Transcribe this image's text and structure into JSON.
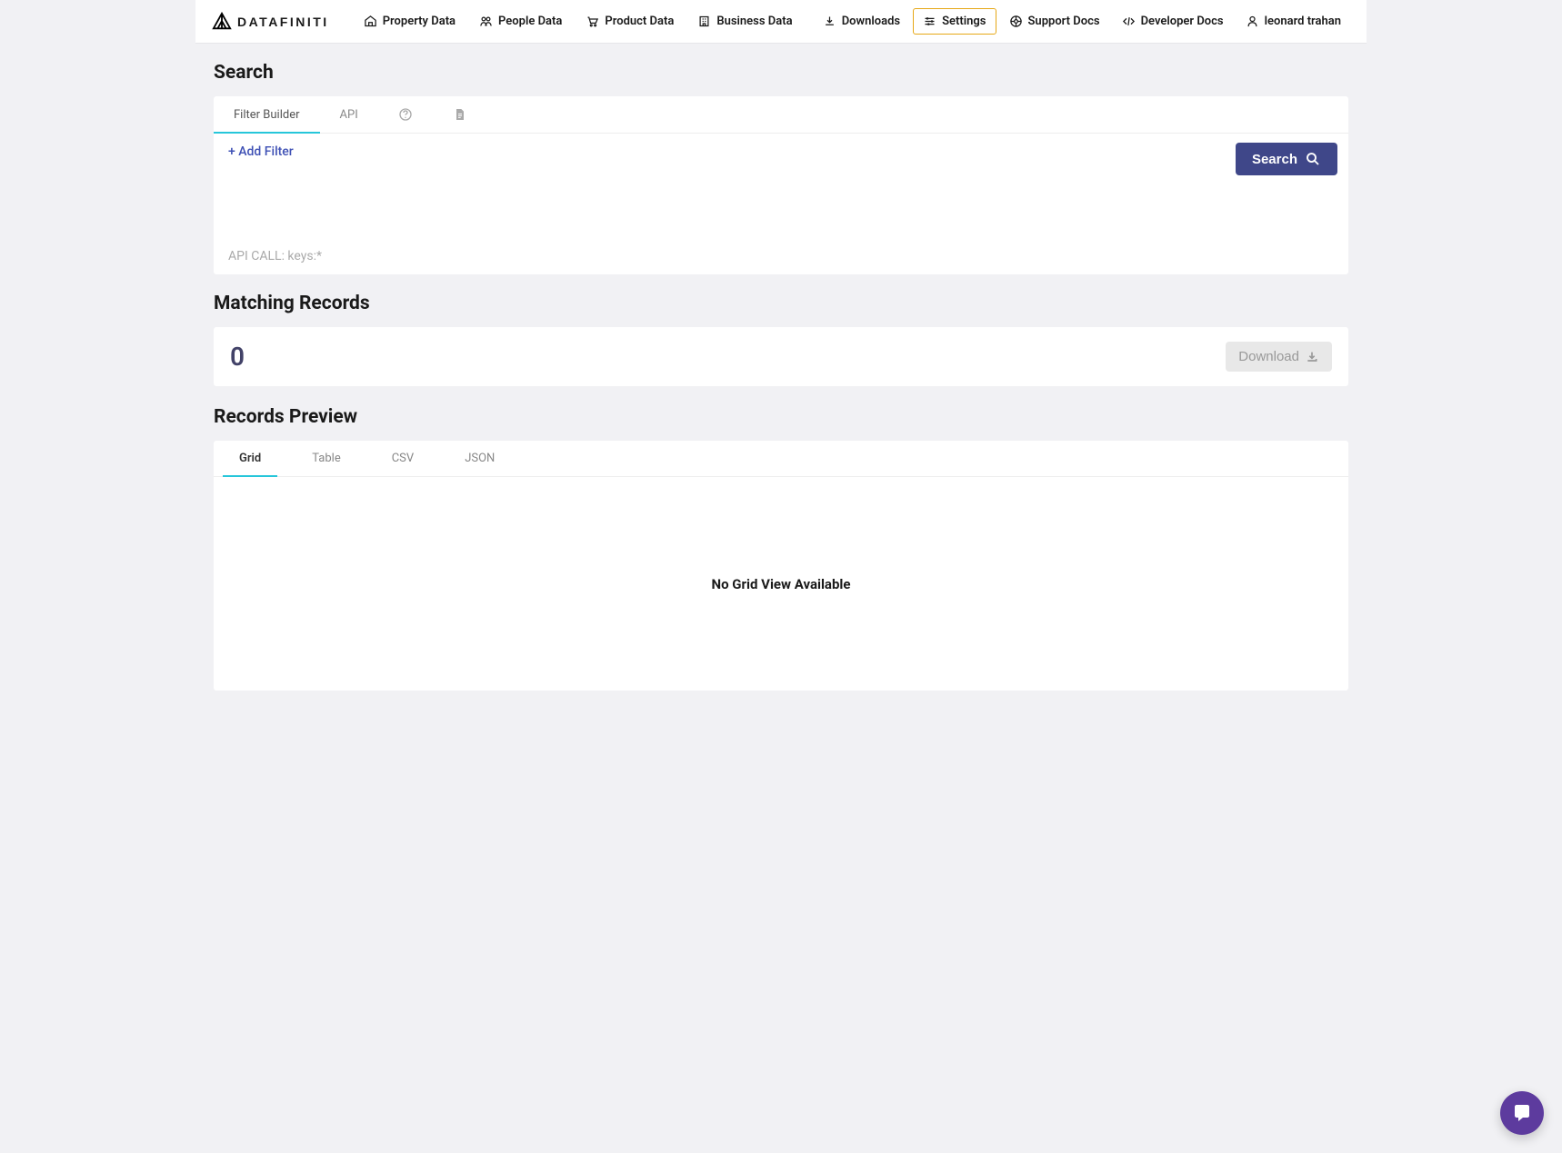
{
  "brand": {
    "name": "DATAFINITI"
  },
  "nav": {
    "left": [
      {
        "label": "Property Data"
      },
      {
        "label": "People Data"
      },
      {
        "label": "Product Data"
      },
      {
        "label": "Business Data"
      }
    ],
    "right": {
      "downloads": "Downloads",
      "settings": "Settings",
      "support": "Support Docs",
      "developer": "Developer Docs",
      "user": "leonard trahan"
    }
  },
  "search": {
    "title": "Search",
    "tabs": {
      "filter_builder": "Filter Builder",
      "api": "API"
    },
    "add_filter": "+ Add Filter",
    "search_btn": "Search",
    "api_call": "API CALL: keys:*"
  },
  "matching": {
    "title": "Matching Records",
    "count": "0",
    "download_btn": "Download"
  },
  "preview": {
    "title": "Records Preview",
    "tabs": {
      "grid": "Grid",
      "table": "Table",
      "csv": "CSV",
      "json": "JSON"
    },
    "no_grid": "No Grid View Available"
  }
}
